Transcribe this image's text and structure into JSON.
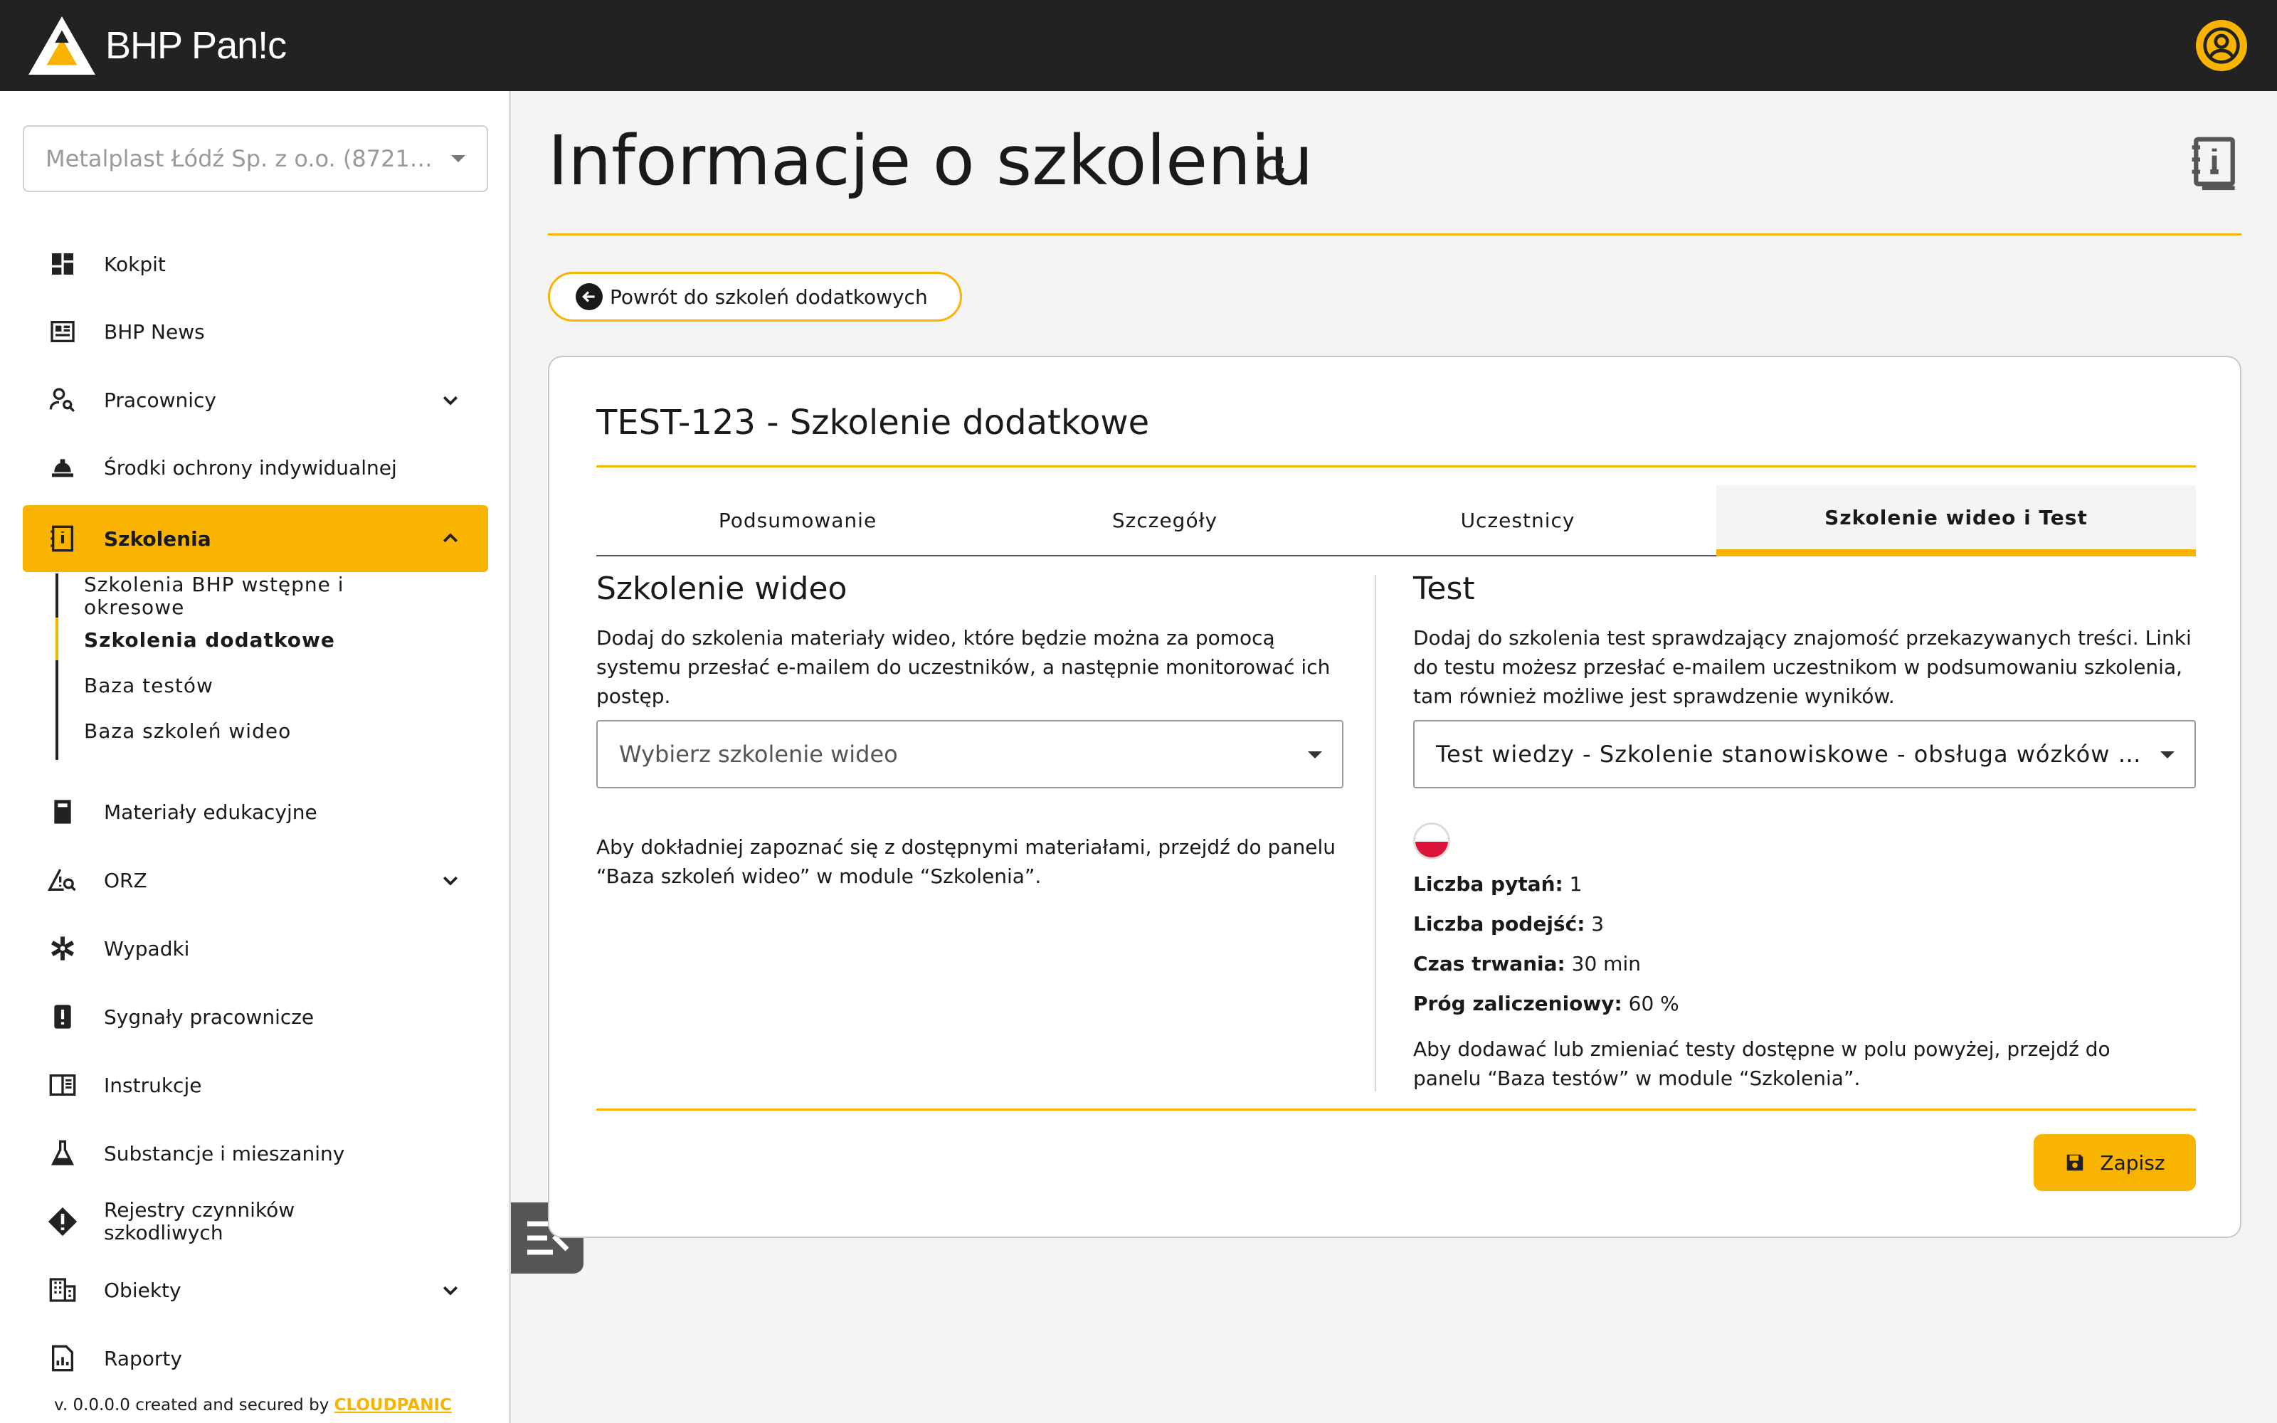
{
  "app": {
    "logo_text": "BHP Pan!c"
  },
  "sidebar": {
    "company": "Metalplast Łódź Sp. z o.o. (8721…",
    "items": [
      {
        "label": "Kokpit",
        "icon": "dashboard-icon"
      },
      {
        "label": "BHP News",
        "icon": "news-icon"
      },
      {
        "label": "Pracownicy",
        "icon": "person-search-icon"
      },
      {
        "label": "Środki ochrony indywidualnej",
        "icon": "helmet-icon"
      },
      {
        "label": "Szkolenia",
        "icon": "training-book-icon"
      },
      {
        "label": "Materiały edukacyjne",
        "icon": "book-icon"
      },
      {
        "label": "ORZ",
        "icon": "risk-icon"
      },
      {
        "label": "Wypadki",
        "icon": "medical-icon"
      },
      {
        "label": "Sygnały pracownicze",
        "icon": "alert-icon"
      },
      {
        "label": "Instrukcje",
        "icon": "instructions-icon"
      },
      {
        "label": "Substancje i mieszaniny",
        "icon": "flask-icon"
      },
      {
        "label": "Rejestry czynników szkodliwych",
        "icon": "warning-icon"
      },
      {
        "label": "Obiekty",
        "icon": "building-icon"
      },
      {
        "label": "Raporty",
        "icon": "report-icon"
      }
    ],
    "sub_items": [
      "Szkolenia BHP wstępne i okresowe",
      "Szkolenia dodatkowe",
      "Baza testów",
      "Baza szkoleń wideo"
    ],
    "footer_prefix": "v. 0.0.0.0 created and secured by",
    "footer_brand": "CLOUDPANIC"
  },
  "header": {
    "title": "Informacje o szkoleniu",
    "back_label": "Powrót do szkoleń dodatkowych"
  },
  "card": {
    "title": "TEST-123 - Szkolenie dodatkowe",
    "tabs": [
      "Podsumowanie",
      "Szczegóły",
      "Uczestnicy",
      "Szkolenie wideo i Test"
    ],
    "video": {
      "title": "Szkolenie wideo",
      "desc": "Dodaj do szkolenia materiały wideo, które będzie można za pomocą systemu przesłać e-mailem do uczestników, a następnie monitorować ich postęp.",
      "placeholder": "Wybierz szkolenie wideo",
      "note": "Aby dokładniej zapoznać się z dostępnymi materiałami, przejdź do panelu “Baza szkoleń wideo” w module “Szkolenia”."
    },
    "test": {
      "title": "Test",
      "desc": "Dodaj do szkolenia test sprawdzający znajomość przekazywanych treści. Linki do testu możesz przesłać e-mailem uczestnikom w podsumowaniu szkolenia, tam również możliwe jest sprawdzenie wyników.",
      "selected": "Test wiedzy - Szkolenie stanowiskowe - obsługa wózków wi…",
      "stats": [
        {
          "label": "Liczba pytań:",
          "value": "1"
        },
        {
          "label": "Liczba podejść:",
          "value": "3"
        },
        {
          "label": "Czas trwania:",
          "value": "30 min"
        },
        {
          "label": "Próg zaliczeniowy:",
          "value": "60 %"
        }
      ],
      "note": "Aby dodawać lub zmieniać testy dostępne w polu powyżej, przejdź do panelu “Baza testów” w module “Szkolenia”."
    },
    "save_label": "Zapisz"
  },
  "colors": {
    "accent": "#f8b400",
    "topbar": "#222222"
  }
}
